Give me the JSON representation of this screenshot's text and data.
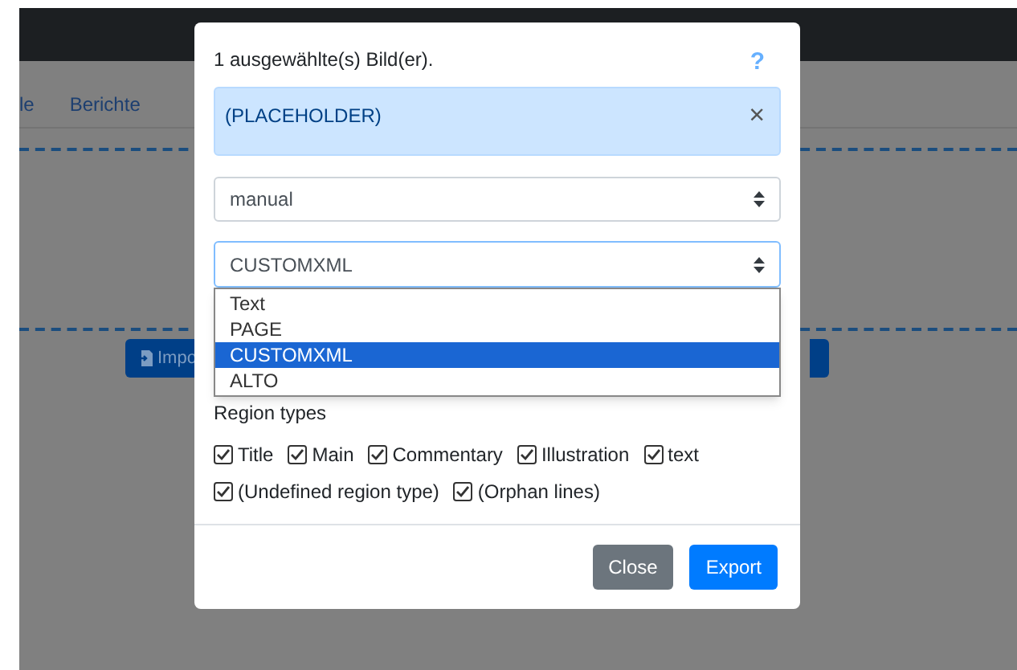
{
  "background": {
    "nav_tabs": [
      {
        "label": "le"
      },
      {
        "label": "Berichte"
      }
    ],
    "import_button": {
      "label": "Impo"
    }
  },
  "dialog": {
    "message": "1 ausgewählte(s) Bild(er).",
    "help": "?",
    "alert": {
      "text": "(PLACEHOLDER)",
      "close": "×"
    },
    "mode_select": {
      "value": "manual"
    },
    "format_select": {
      "value": "CUSTOMXML",
      "expanded": true,
      "options": [
        {
          "label": "Text",
          "selected": false
        },
        {
          "label": "PAGE",
          "selected": false
        },
        {
          "label": "CUSTOMXML",
          "selected": true
        },
        {
          "label": "ALTO",
          "selected": false
        }
      ]
    },
    "region_types": {
      "label": "Region types",
      "items": [
        {
          "label": "Title",
          "checked": true
        },
        {
          "label": "Main",
          "checked": true
        },
        {
          "label": "Commentary",
          "checked": true
        },
        {
          "label": "Illustration",
          "checked": true
        },
        {
          "label": "text",
          "checked": true
        },
        {
          "label": "(Undefined region type)",
          "checked": true
        },
        {
          "label": "(Orphan lines)",
          "checked": true
        }
      ]
    },
    "buttons": [
      {
        "label": "Close",
        "kind": "secondary"
      },
      {
        "label": "Export",
        "kind": "primary"
      }
    ]
  }
}
